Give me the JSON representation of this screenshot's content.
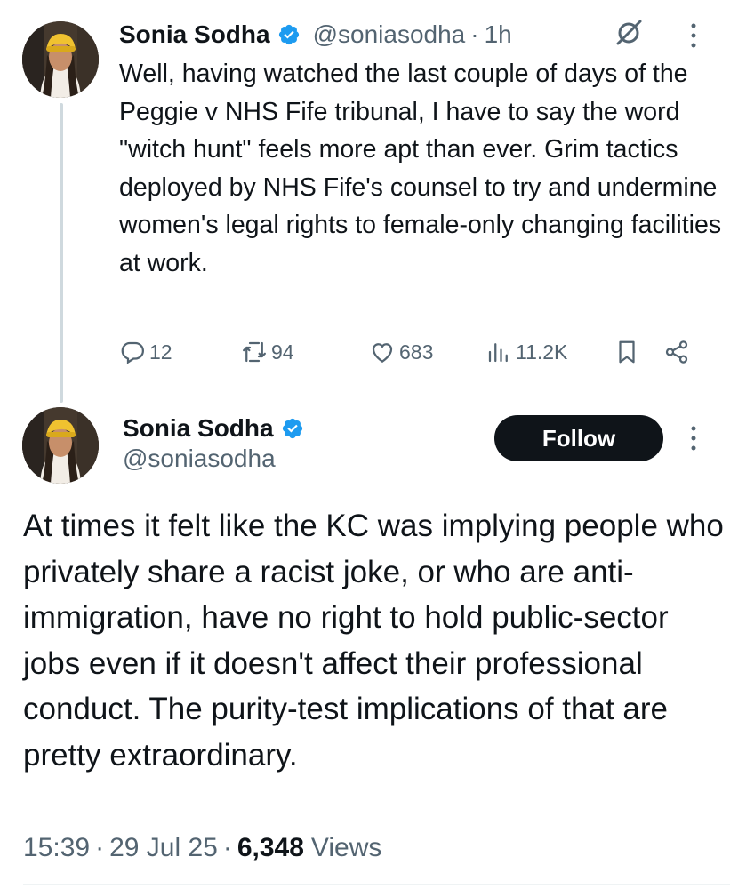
{
  "quoted_tweet": {
    "author_name": "Sonia Sodha",
    "handle": "@soniasodha",
    "time_sep": "·",
    "time": "1h",
    "text": "Well, having watched the last couple of days of the Peggie v NHS Fife tribunal, I have to say the word \"witch hunt\" feels more apt than ever. Grim tactics deployed by NHS Fife's counsel to try and undermine women's legal rights to female-only changing facilities at work.",
    "actions": {
      "replies": "12",
      "reposts": "94",
      "likes": "683",
      "views": "11.2K"
    }
  },
  "main_tweet": {
    "author_name": "Sonia Sodha",
    "handle": "@soniasodha",
    "follow_label": "Follow",
    "text": "At times it felt like the KC was implying people who privately share a racist joke, or who are anti-immigration, have no right to hold public-sector jobs even if it doesn't affect their professional conduct. The purity-test implications of that are pretty extraordinary.",
    "time": "15:39",
    "date": "29 Jul 25",
    "sep": "·",
    "views_count": "6,348",
    "views_label": "Views"
  },
  "colors": {
    "text_primary": "#0f1419",
    "text_secondary": "#536471",
    "verified_blue": "#1d9bf0",
    "follow_bg": "#0f1419",
    "thread_line": "#cfd9de"
  },
  "icons": [
    "verified-badge-icon",
    "grok-icon",
    "more-icon",
    "reply-icon",
    "repost-icon",
    "like-icon",
    "views-icon",
    "bookmark-icon",
    "share-icon"
  ]
}
